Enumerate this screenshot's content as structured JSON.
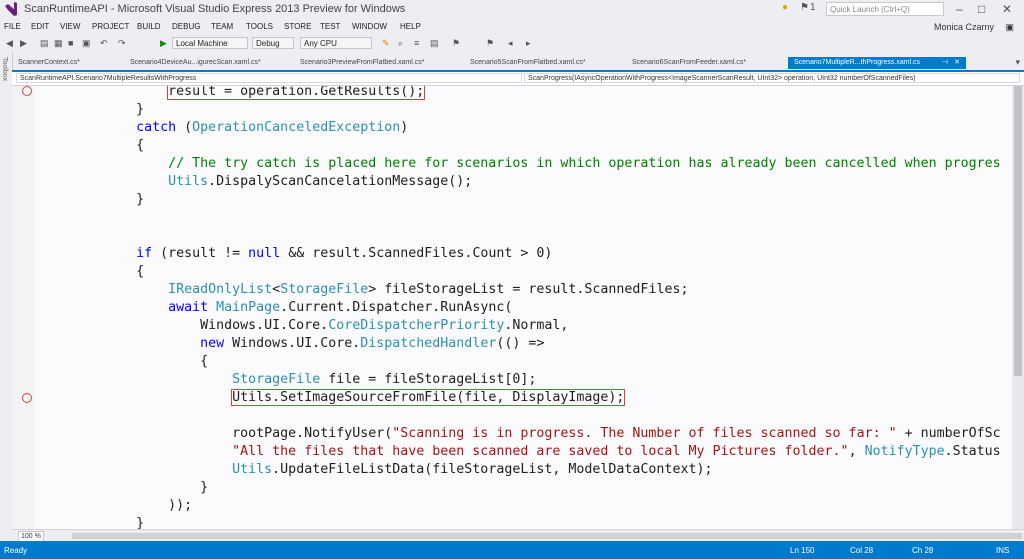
{
  "window": {
    "title": "ScanRuntimeAPI - Microsoft Visual Studio Express 2013 Preview for Windows",
    "notifications": "1",
    "quick_launch_placeholder": "Quick Launch (Ctrl+Q)",
    "user": "Monica Czarny"
  },
  "menu": [
    "FILE",
    "EDIT",
    "VIEW",
    "PROJECT",
    "BUILD",
    "DEBUG",
    "TEAM",
    "TOOLS",
    "STORE",
    "TEST",
    "WINDOW",
    "HELP"
  ],
  "toolbar": {
    "run_target": "Local Machine",
    "configuration": "Debug",
    "platform": "Any CPU"
  },
  "toolbox_label": "Toolbox",
  "tabs": [
    "ScannerContext.cs*",
    "Scenario4DeviceAu...igurecScan.xaml.cs*",
    "Scenario3PreviewFromFlatbed.xaml.cs*",
    "Scenario5ScanFromFlatbed.xaml.cs*",
    "Scenario6ScanFromFeeder.xaml.cs*",
    "Scenario7MultipleR...thProgress.xaml.cs"
  ],
  "navbar": {
    "left": "ScanRuntimeAPI.Scenario7MultipleResultsWithProgress",
    "right": "ScanProgress(IAsyncOperationWithProgress<ImageScannerScanResult, UInt32> operation, UInt32 numberOfScannedFiles)"
  },
  "code": [
    [
      {
        "t": "                result = operation.GetResults();",
        "c": "boxed"
      }
    ],
    [
      {
        "t": "            }",
        "c": ""
      }
    ],
    [
      {
        "t": "            ",
        "c": ""
      },
      {
        "t": "catch",
        "c": "kw"
      },
      {
        "t": " (",
        "c": ""
      },
      {
        "t": "OperationCanceledException",
        "c": "ty"
      },
      {
        "t": ")",
        "c": ""
      }
    ],
    [
      {
        "t": "            {",
        "c": ""
      }
    ],
    [
      {
        "t": "                // The try catch is placed here for scenarios in which operation has already been cancelled when progres",
        "c": "cm"
      }
    ],
    [
      {
        "t": "                ",
        "c": ""
      },
      {
        "t": "Utils",
        "c": "ty"
      },
      {
        "t": ".DispalyScanCancelationMessage();",
        "c": ""
      }
    ],
    [
      {
        "t": "            }",
        "c": ""
      }
    ],
    [
      {
        "t": "",
        "c": ""
      }
    ],
    [
      {
        "t": "",
        "c": ""
      }
    ],
    [
      {
        "t": "            ",
        "c": ""
      },
      {
        "t": "if",
        "c": "kw"
      },
      {
        "t": " (result != ",
        "c": ""
      },
      {
        "t": "null",
        "c": "kw"
      },
      {
        "t": " && result.ScannedFiles.Count > 0)",
        "c": ""
      }
    ],
    [
      {
        "t": "            {",
        "c": ""
      }
    ],
    [
      {
        "t": "                ",
        "c": ""
      },
      {
        "t": "IReadOnlyList",
        "c": "ty"
      },
      {
        "t": "<",
        "c": ""
      },
      {
        "t": "StorageFile",
        "c": "ty"
      },
      {
        "t": "> fileStorageList = result.ScannedFiles;",
        "c": ""
      }
    ],
    [
      {
        "t": "                ",
        "c": ""
      },
      {
        "t": "await",
        "c": "kw"
      },
      {
        "t": " ",
        "c": ""
      },
      {
        "t": "MainPage",
        "c": "ty"
      },
      {
        "t": ".Current.Dispatcher.RunAsync(",
        "c": ""
      }
    ],
    [
      {
        "t": "                    Windows.UI.Core.",
        "c": ""
      },
      {
        "t": "CoreDispatcherPriority",
        "c": "ty"
      },
      {
        "t": ".Normal,",
        "c": ""
      }
    ],
    [
      {
        "t": "                    ",
        "c": ""
      },
      {
        "t": "new",
        "c": "kw"
      },
      {
        "t": " Windows.UI.Core.",
        "c": ""
      },
      {
        "t": "DispatchedHandler",
        "c": "ty"
      },
      {
        "t": "(() =>",
        "c": ""
      }
    ],
    [
      {
        "t": "                    {",
        "c": ""
      }
    ],
    [
      {
        "t": "                        ",
        "c": ""
      },
      {
        "t": "StorageFile",
        "c": "ty"
      },
      {
        "t": " file = fileStorageList[0];",
        "c": ""
      }
    ],
    [
      {
        "t": "                        ",
        "c": ""
      },
      {
        "t": "Utils.SetImageSourceFromFile(file, DisplayImage);",
        "c": "boxed"
      }
    ],
    [
      {
        "t": "",
        "c": ""
      }
    ],
    [
      {
        "t": "                        rootPage.NotifyUser(",
        "c": ""
      },
      {
        "t": "\"Scanning is in progress. The Number of files scanned so far: \"",
        "c": "str"
      },
      {
        "t": " + numberOfSc",
        "c": ""
      }
    ],
    [
      {
        "t": "                        ",
        "c": ""
      },
      {
        "t": "\"All the files that have been scanned are saved to local My Pictures folder.\"",
        "c": "str"
      },
      {
        "t": ", ",
        "c": ""
      },
      {
        "t": "NotifyType",
        "c": "ty"
      },
      {
        "t": ".Status",
        "c": ""
      }
    ],
    [
      {
        "t": "                        ",
        "c": ""
      },
      {
        "t": "Utils",
        "c": "ty"
      },
      {
        "t": ".UpdateFileListData(fileStorageList, ModelDataContext);",
        "c": ""
      }
    ],
    [
      {
        "t": "                    }",
        "c": ""
      }
    ],
    [
      {
        "t": "                ));",
        "c": ""
      }
    ],
    [
      {
        "t": "            }",
        "c": ""
      }
    ]
  ],
  "zoom": "100 %",
  "status": {
    "left": "Ready",
    "ln": "Ln 150",
    "col": "Col 28",
    "ch": "Ch 28",
    "ins": "INS"
  }
}
